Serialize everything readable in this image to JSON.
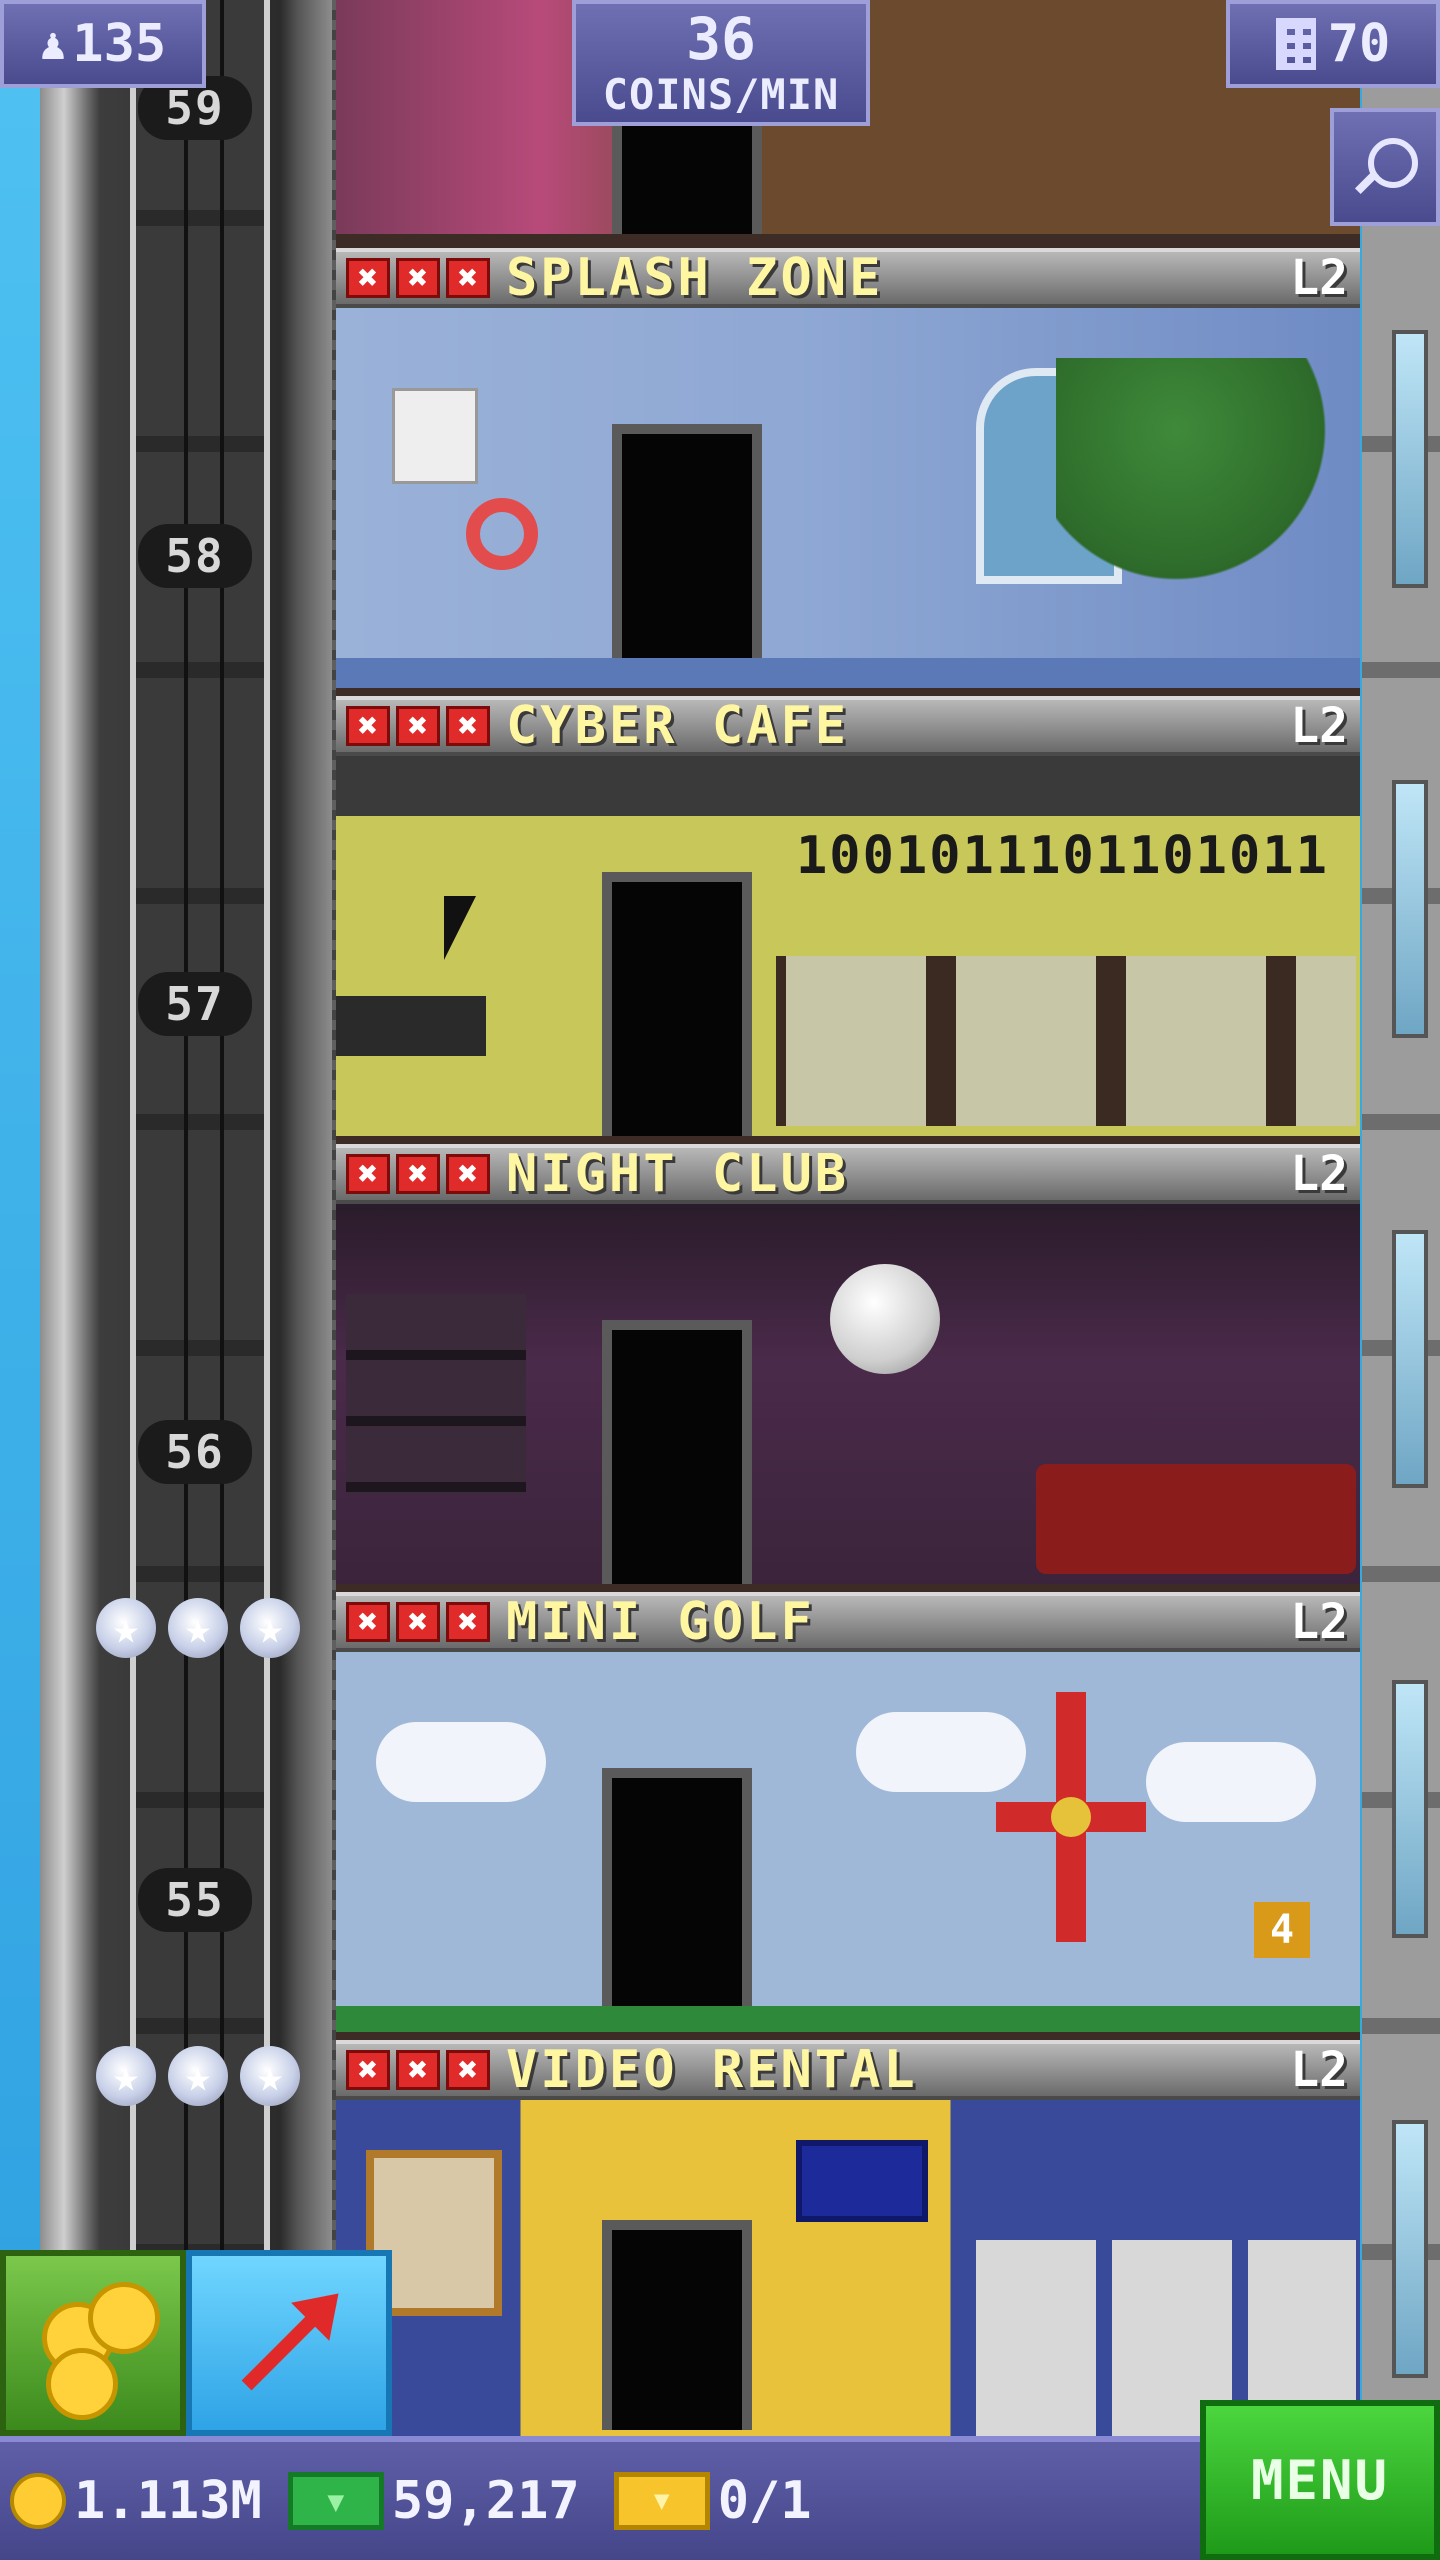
{
  "hud": {
    "population": "135",
    "coins_per_min_value": "36",
    "coins_per_min_label": "COINS/MIN",
    "floors_count": "70",
    "population_icon": "person-icon",
    "floors_icon": "building-icon",
    "zoom_icon": "magnifier-icon"
  },
  "elevator": {
    "floor_numbers": [
      "59",
      "58",
      "57",
      "56",
      "55"
    ]
  },
  "floors": [
    {
      "name": "SPLASH ZONE",
      "level": "L2",
      "mark": "✖"
    },
    {
      "name": "CYBER CAFE",
      "level": "L2",
      "mark": "✖",
      "wall_text": "1001011101101011"
    },
    {
      "name": "NIGHT CLUB",
      "level": "L2",
      "mark": "✖"
    },
    {
      "name": "MINI GOLF",
      "level": "L2",
      "mark": "✖",
      "hole_sign": "4"
    },
    {
      "name": "VIDEO RENTAL",
      "level": "L2",
      "mark": "✖"
    }
  ],
  "bottom_bar": {
    "coins": "1.113M",
    "bux": "59,217",
    "tickets": "0/1",
    "menu_label": "MENU"
  },
  "colors": {
    "hud_purple": "#5a5aa0",
    "header_text": "#fff6a2",
    "x_mark_red": "#e12b2b",
    "menu_green": "#2fb42a"
  }
}
